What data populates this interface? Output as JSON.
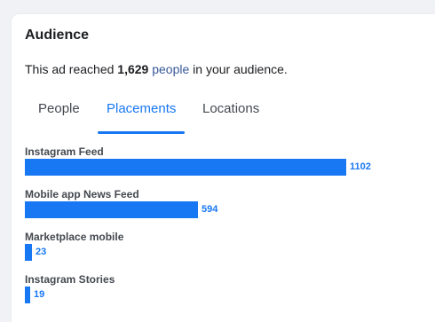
{
  "audience": {
    "title": "Audience",
    "reach_prefix": "This ad reached ",
    "reach_count": "1,629",
    "reach_link": "people",
    "reach_suffix": " in your audience."
  },
  "tabs": [
    {
      "label": "People",
      "active": false
    },
    {
      "label": "Placements",
      "active": true
    },
    {
      "label": "Locations",
      "active": false
    }
  ],
  "colors": {
    "accent": "#1877f2",
    "link": "#385898",
    "text": "#1c1e21",
    "muted": "#444950"
  },
  "chart_data": {
    "type": "bar",
    "orientation": "horizontal",
    "categories": [
      "Instagram Feed",
      "Mobile app News Feed",
      "Marketplace mobile",
      "Instagram Stories"
    ],
    "values": [
      1102,
      594,
      23,
      19
    ],
    "labels": [
      "1102",
      "594",
      "23",
      "19"
    ],
    "xlim": [
      0,
      1102
    ]
  }
}
